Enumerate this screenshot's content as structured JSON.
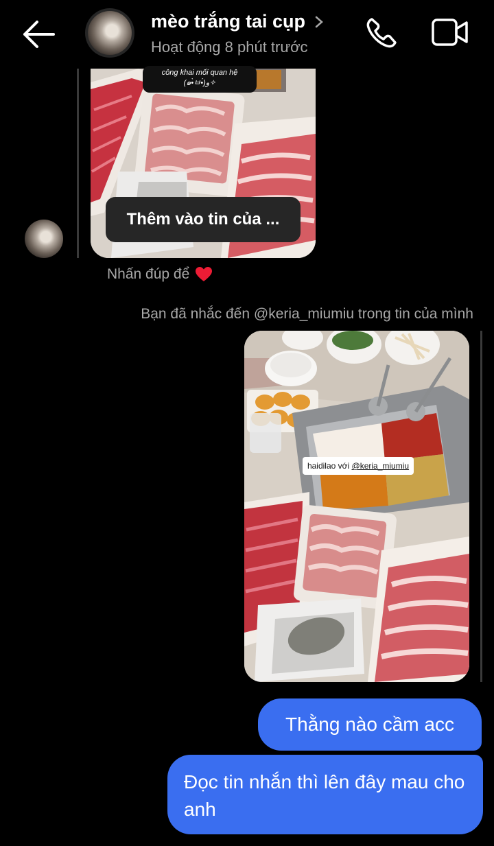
{
  "header": {
    "name": "mèo trắng tai cụp",
    "status": "Hoạt động 8 phút trước"
  },
  "received_story": {
    "sticker_line1": "công khai mối quan hệ",
    "sticker_line2": "(๑•̀ㅂ•́)و✧",
    "add_button": "Thêm vào tin của ...",
    "hint": "Nhấn đúp để"
  },
  "mention_note": "Bạn đã nhắc đến @keria_miumiu trong tin của mình",
  "sent_story": {
    "tag_prefix": "haidilao với ",
    "tag_user": "@keria_miumiu"
  },
  "messages": [
    {
      "text": "Thằng nào cầm acc"
    },
    {
      "text": "Đọc tin nhắn thì lên đây mau cho anh"
    }
  ],
  "colors": {
    "bubble": "#3a6ef0",
    "background": "#000000"
  }
}
